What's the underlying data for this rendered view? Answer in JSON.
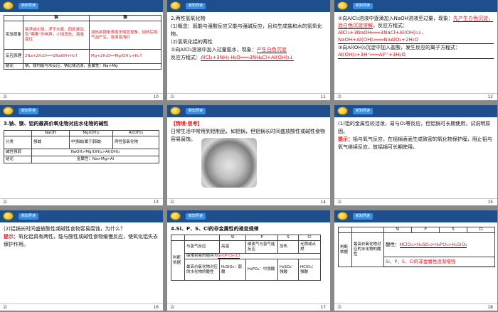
{
  "header_tag": "新知导读",
  "footer_mark": "冶",
  "slides": [
    {
      "number": "10",
      "table": {
        "col_heads": [
          "",
          "钠",
          "镁"
        ],
        "rows": [
          [
            "实验现象",
            "钠浮成小球，浮于水面，四处游动，有“嘶嘶”的响声，小球消失，溶液变红",
            "加热前镁条表面无明显现象，加热后有气泡产生，溶液变浅红"
          ],
          [
            "反应原理",
            "2Na+2H₂O═══2NaOH+H₂↑",
            "Mg+2H₂O══Mg(OH)₂+H₂↑"
          ],
          [
            "结论",
            "钠、镁均能与水反应，钠比镁活泼，金属性：Na>Mg",
            ""
          ]
        ]
      }
    },
    {
      "number": "11",
      "title": "2.两性氢氧化物",
      "line1": "(1)概念：既能与强酸反应又能与强碱反应，且均生成盐和水的氢氧化物。",
      "line2": "(2)氢氧化铝的两性",
      "line3": "①向AlCl₃溶液中加入过量氨水，现象：",
      "answer1": "产生白色沉淀",
      "line4": "反应方程式：",
      "equation1": "AlCl₃+3NH₃·H₂O═══3NH₄Cl+Al(OH)₃↓"
    },
    {
      "number": "12",
      "line1": "②向AlCl₃溶液中逐滴加入NaOH溶液至过量，现象：",
      "answer1": "先产生白色沉淀，后白色沉淀溶解",
      "line2": "，反应方程式：",
      "equation1": "AlCl₃+3NaOH═══3NaCl+Al(OH)₃↓、NaOH+Al(OH)₃═══NaAlO₂+2H₂O",
      "line3": "③向Al(OH)₃沉淀中加入盐酸，发生反应的离子方程式：",
      "equation2": "Al(OH)₃+3H⁺═══Al³⁺+3H₂O"
    },
    {
      "number": "13",
      "title": "3.钠、镁、铝的最高价氧化物对应水化物的碱性",
      "table": {
        "col_heads": [
          "",
          "NaOH",
          "Mg(OH)₂",
          "Al(OH)₃"
        ],
        "rows": [
          [
            "分类",
            "强碱",
            "中强碱(属于弱碱)",
            "两性氢氧化物"
          ],
          [
            "碱性强弱",
            "NaOH>Mg(OH)₂>Al(OH)₃"
          ],
          [
            "结论",
            "金属性：Na>Mg>Al"
          ]
        ]
      }
    },
    {
      "number": "14",
      "heading": "【情境·思考】",
      "text": "日常生活中常用到铝制品，如铝锅，但铝锅长时间盛放酸性或碱性食物容易腐蚀。"
    },
    {
      "number": "15",
      "question": "(1)铝的金属性较活泼，易与O₂等反应，但铝锅可长期使用，试说明原因。",
      "hint_label": "提示：",
      "hint": "铝与氧气反应，在铝锅表面生成致密的氧化物保护膜，阻止铝与氧气继续反应，故铝锅可长期使用。"
    },
    {
      "number": "16",
      "question": "(2)铝锅长时间盛放酸性或碱性食物容易腐蚀，为什么？",
      "hint_label": "提示：",
      "hint": "氧化铝具有两性，能与酸性或碱性食物缓慢反应，使氧化铝失去保护作用。"
    },
    {
      "number": "17",
      "title": "4.Si、P、S、Cl的非金属性的递变规律",
      "table": {
        "col_heads": [
          "",
          "",
          "Si",
          "P",
          "S",
          "Cl"
        ],
        "side_label": "判断依据",
        "row1_label": "与氢气反应",
        "row1": [
          "高温",
          "磷蒸气与氢气能反应",
          "加热",
          "光照或点燃"
        ],
        "row1_order_prefix": "由难到易的顺序为",
        "row1_order": "Si<P<S<Cl",
        "row2_label": "最高价氧化物对应的水化物的酸性",
        "row2": [
          "H₂SiO₃：弱酸",
          "H₃PO₄：中强酸",
          "H₂SO₄：强酸",
          "HClO₄：强酸"
        ]
      }
    },
    {
      "number": "18",
      "table": {
        "col_heads": [
          "",
          "",
          "Si",
          "P",
          "S",
          "Cl"
        ],
        "side_label": "判断依据",
        "row_label": "最高价氧化物对应的水化物的酸性",
        "acid_prefix": "酸性：",
        "acid_order": "HClO₄>H₂SO₄>H₃PO₄>H₂SiO₃",
        "conclusion": "Si、P、S、Cl的非金属性逐渐增强"
      }
    }
  ]
}
